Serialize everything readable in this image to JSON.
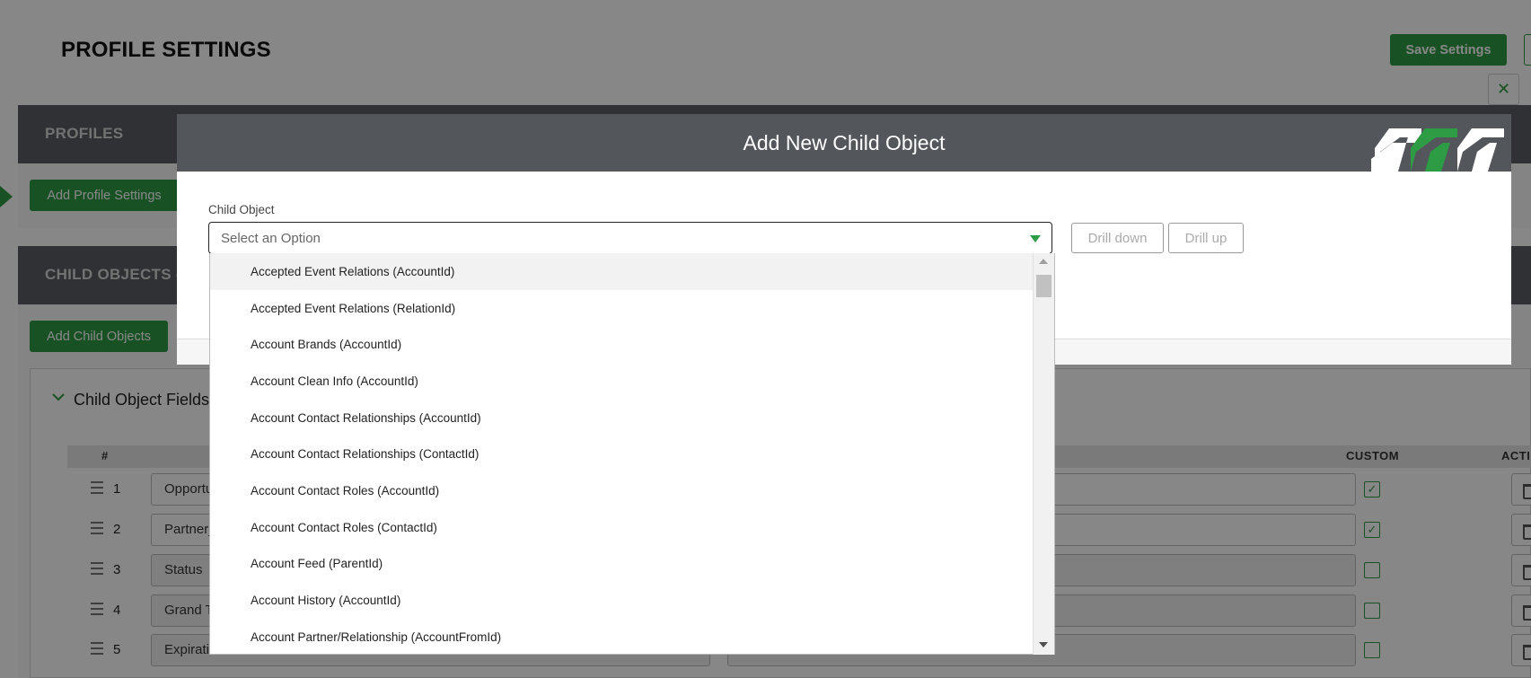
{
  "page": {
    "title": "PROFILE SETTINGS",
    "save_label": "Save Settings",
    "close_symbol": "✕"
  },
  "profiles": {
    "header": "PROFILES",
    "add_label": "Add Profile Settings"
  },
  "child_objects": {
    "header": "CHILD OBJECTS -",
    "add_label": "Add Child Objects",
    "panel_title": "Child Object Fields",
    "columns": {
      "num": "#",
      "custom": "CUSTOM",
      "actions": "ACTI"
    },
    "rows": [
      {
        "num": "1",
        "field": "Opportu",
        "custom": true,
        "readonly": false
      },
      {
        "num": "2",
        "field": "Partner_",
        "custom": true,
        "readonly": false
      },
      {
        "num": "3",
        "field": "Status",
        "custom": false,
        "readonly": true
      },
      {
        "num": "4",
        "field": "Grand T",
        "custom": false,
        "readonly": true
      },
      {
        "num": "5",
        "field": "Expiratio",
        "custom": false,
        "readonly": true
      }
    ]
  },
  "modal": {
    "title": "Add New Child Object",
    "field_label": "Child Object",
    "placeholder": "Select an Option",
    "drill_down": "Drill down",
    "drill_up": "Drill up",
    "options": [
      "Accepted Event Relations (AccountId)",
      "Accepted Event Relations (RelationId)",
      "Account Brands (AccountId)",
      "Account Clean Info (AccountId)",
      "Account Contact Relationships (AccountId)",
      "Account Contact Relationships (ContactId)",
      "Account Contact Roles (AccountId)",
      "Account Contact Roles (ContactId)",
      "Account Feed (ParentId)",
      "Account History (AccountId)",
      "Account Partner/Relationship (AccountFromId)"
    ],
    "highlighted_index": 0
  },
  "colors": {
    "accent_green": "#2e9c44",
    "header_gray": "#53575c"
  }
}
